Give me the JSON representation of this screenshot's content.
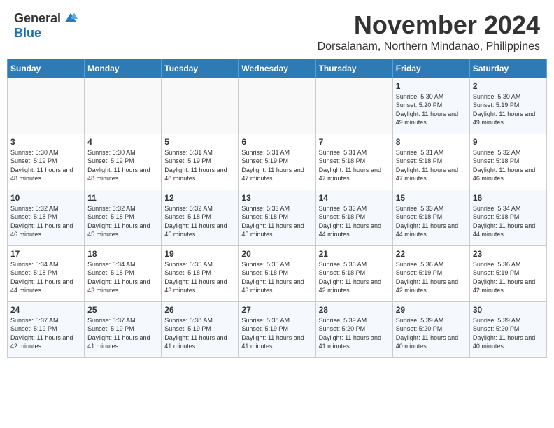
{
  "header": {
    "logo_general": "General",
    "logo_blue": "Blue",
    "month_title": "November 2024",
    "location": "Dorsalanam, Northern Mindanao, Philippines"
  },
  "weekdays": [
    "Sunday",
    "Monday",
    "Tuesday",
    "Wednesday",
    "Thursday",
    "Friday",
    "Saturday"
  ],
  "weeks": [
    [
      {
        "day": "",
        "info": ""
      },
      {
        "day": "",
        "info": ""
      },
      {
        "day": "",
        "info": ""
      },
      {
        "day": "",
        "info": ""
      },
      {
        "day": "",
        "info": ""
      },
      {
        "day": "1",
        "info": "Sunrise: 5:30 AM\nSunset: 5:20 PM\nDaylight: 11 hours and 49 minutes."
      },
      {
        "day": "2",
        "info": "Sunrise: 5:30 AM\nSunset: 5:19 PM\nDaylight: 11 hours and 49 minutes."
      }
    ],
    [
      {
        "day": "3",
        "info": "Sunrise: 5:30 AM\nSunset: 5:19 PM\nDaylight: 11 hours and 48 minutes."
      },
      {
        "day": "4",
        "info": "Sunrise: 5:30 AM\nSunset: 5:19 PM\nDaylight: 11 hours and 48 minutes."
      },
      {
        "day": "5",
        "info": "Sunrise: 5:31 AM\nSunset: 5:19 PM\nDaylight: 11 hours and 48 minutes."
      },
      {
        "day": "6",
        "info": "Sunrise: 5:31 AM\nSunset: 5:19 PM\nDaylight: 11 hours and 47 minutes."
      },
      {
        "day": "7",
        "info": "Sunrise: 5:31 AM\nSunset: 5:18 PM\nDaylight: 11 hours and 47 minutes."
      },
      {
        "day": "8",
        "info": "Sunrise: 5:31 AM\nSunset: 5:18 PM\nDaylight: 11 hours and 47 minutes."
      },
      {
        "day": "9",
        "info": "Sunrise: 5:32 AM\nSunset: 5:18 PM\nDaylight: 11 hours and 46 minutes."
      }
    ],
    [
      {
        "day": "10",
        "info": "Sunrise: 5:32 AM\nSunset: 5:18 PM\nDaylight: 11 hours and 46 minutes."
      },
      {
        "day": "11",
        "info": "Sunrise: 5:32 AM\nSunset: 5:18 PM\nDaylight: 11 hours and 45 minutes."
      },
      {
        "day": "12",
        "info": "Sunrise: 5:32 AM\nSunset: 5:18 PM\nDaylight: 11 hours and 45 minutes."
      },
      {
        "day": "13",
        "info": "Sunrise: 5:33 AM\nSunset: 5:18 PM\nDaylight: 11 hours and 45 minutes."
      },
      {
        "day": "14",
        "info": "Sunrise: 5:33 AM\nSunset: 5:18 PM\nDaylight: 11 hours and 44 minutes."
      },
      {
        "day": "15",
        "info": "Sunrise: 5:33 AM\nSunset: 5:18 PM\nDaylight: 11 hours and 44 minutes."
      },
      {
        "day": "16",
        "info": "Sunrise: 5:34 AM\nSunset: 5:18 PM\nDaylight: 11 hours and 44 minutes."
      }
    ],
    [
      {
        "day": "17",
        "info": "Sunrise: 5:34 AM\nSunset: 5:18 PM\nDaylight: 11 hours and 44 minutes."
      },
      {
        "day": "18",
        "info": "Sunrise: 5:34 AM\nSunset: 5:18 PM\nDaylight: 11 hours and 43 minutes."
      },
      {
        "day": "19",
        "info": "Sunrise: 5:35 AM\nSunset: 5:18 PM\nDaylight: 11 hours and 43 minutes."
      },
      {
        "day": "20",
        "info": "Sunrise: 5:35 AM\nSunset: 5:18 PM\nDaylight: 11 hours and 43 minutes."
      },
      {
        "day": "21",
        "info": "Sunrise: 5:36 AM\nSunset: 5:18 PM\nDaylight: 11 hours and 42 minutes."
      },
      {
        "day": "22",
        "info": "Sunrise: 5:36 AM\nSunset: 5:19 PM\nDaylight: 11 hours and 42 minutes."
      },
      {
        "day": "23",
        "info": "Sunrise: 5:36 AM\nSunset: 5:19 PM\nDaylight: 11 hours and 42 minutes."
      }
    ],
    [
      {
        "day": "24",
        "info": "Sunrise: 5:37 AM\nSunset: 5:19 PM\nDaylight: 11 hours and 42 minutes."
      },
      {
        "day": "25",
        "info": "Sunrise: 5:37 AM\nSunset: 5:19 PM\nDaylight: 11 hours and 41 minutes."
      },
      {
        "day": "26",
        "info": "Sunrise: 5:38 AM\nSunset: 5:19 PM\nDaylight: 11 hours and 41 minutes."
      },
      {
        "day": "27",
        "info": "Sunrise: 5:38 AM\nSunset: 5:19 PM\nDaylight: 11 hours and 41 minutes."
      },
      {
        "day": "28",
        "info": "Sunrise: 5:39 AM\nSunset: 5:20 PM\nDaylight: 11 hours and 41 minutes."
      },
      {
        "day": "29",
        "info": "Sunrise: 5:39 AM\nSunset: 5:20 PM\nDaylight: 11 hours and 40 minutes."
      },
      {
        "day": "30",
        "info": "Sunrise: 5:39 AM\nSunset: 5:20 PM\nDaylight: 11 hours and 40 minutes."
      }
    ]
  ]
}
